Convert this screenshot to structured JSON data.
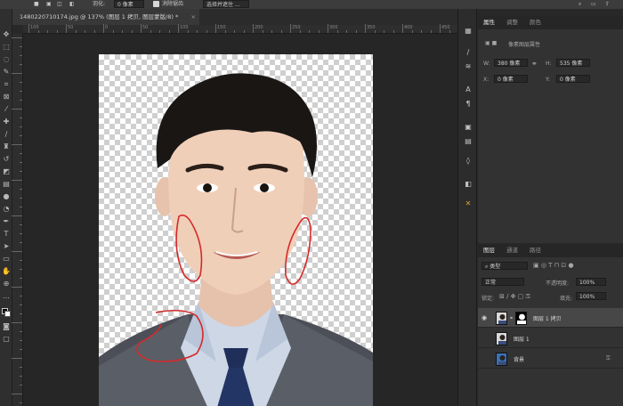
{
  "options_bar": {
    "stroke_label": "羽化:",
    "feather_value": "0 像素",
    "antialias_label": "消除锯齿",
    "select_mask_label": "选择并遮住 ..."
  },
  "document": {
    "tab_title": "1480220710174.jpg @ 137% (图层 1 拷贝, 图层蒙版/8) *",
    "tab_close": "×"
  },
  "ruler": {
    "h_labels": [
      "100",
      "50",
      "0",
      "50",
      "100",
      "150",
      "200",
      "250",
      "300",
      "350",
      "400",
      "450"
    ]
  },
  "properties": {
    "tabs": [
      "属性",
      "调整",
      "颜色"
    ],
    "title": "像素图层属性",
    "w_label": "W:",
    "w_value": "380 像素",
    "h_label": "H:",
    "h_value": "535 像素",
    "x_label": "X:",
    "x_value": "0 像素",
    "y_label": "Y:",
    "y_value": "0 像素",
    "link_icon": "link-icon"
  },
  "layers": {
    "tabs": [
      "图层",
      "通道",
      "路径"
    ],
    "filter_kind": "类型",
    "blend_mode": "正常",
    "opacity_label": "不透明度:",
    "opacity_value": "100%",
    "lock_label": "锁定:",
    "fill_label": "填充:",
    "fill_value": "100%",
    "items": [
      {
        "name": "图层 1 拷贝",
        "visible": true,
        "selected": true,
        "has_mask": true
      },
      {
        "name": "图层 1",
        "visible": false,
        "selected": false,
        "has_mask": false
      },
      {
        "name": "背景",
        "visible": false,
        "selected": false,
        "has_mask": false,
        "locked": true
      }
    ]
  },
  "colors": {
    "accent_red": "#d42a2a",
    "panel_bg": "#323232",
    "selected_row": "#474747"
  }
}
